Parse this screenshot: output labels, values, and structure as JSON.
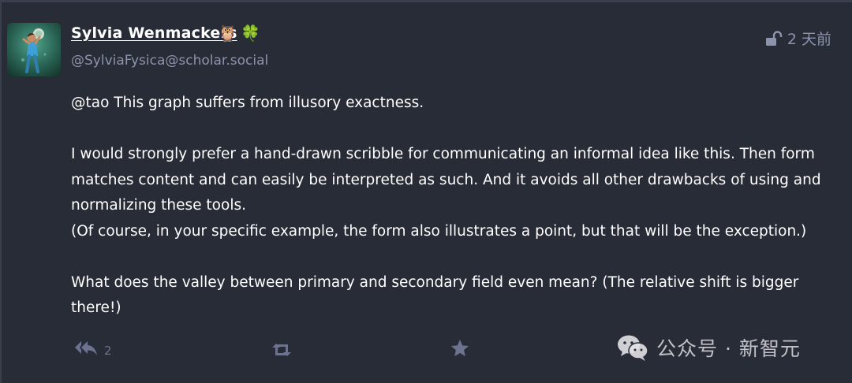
{
  "account": {
    "display_name": "Sylvia Wenmackers",
    "name_emoji": [
      "🦉",
      "🍀"
    ],
    "handle": "@SylviaFysica@scholar.social"
  },
  "meta": {
    "visibility_icon": "unlock-icon",
    "timestamp": "2 天前"
  },
  "content": {
    "paragraphs": [
      [
        "@tao This graph suffers from illusory exactness."
      ],
      [
        "I would strongly prefer a hand-drawn scribble for communicating an informal idea like this. Then form matches content and can easily be interpreted as such. And it avoids all other drawbacks of using and normalizing these tools.",
        "(Of course, in your specific example, the form also illustrates a point, but that will be the exception.)"
      ],
      [
        "What does the valley between primary and secondary field even mean? (The relative shift is bigger there!)"
      ]
    ]
  },
  "actions": {
    "reply_count": "2",
    "reply_icon": "reply-all-icon",
    "boost_icon": "boost-icon",
    "favourite_icon": "star-icon"
  },
  "watermark": {
    "text": "公众号 · 新智元"
  },
  "colors": {
    "background": "#282c37",
    "muted_text": "#8d93ab",
    "action_icon": "#6c7290"
  }
}
